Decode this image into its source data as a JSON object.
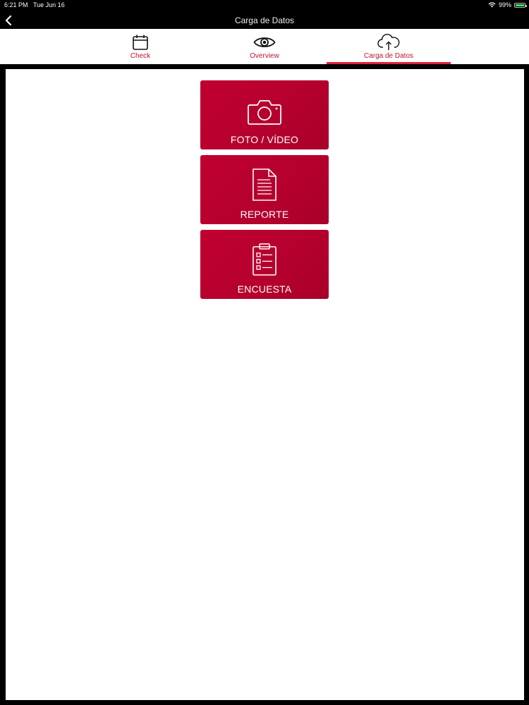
{
  "status_bar": {
    "time": "6:21 PM",
    "date": "Tue Jun 16",
    "battery": "99%"
  },
  "nav": {
    "title": "Carga de Datos",
    "back_icon": "chevron-left-icon"
  },
  "tabs": [
    {
      "label": "Check",
      "icon": "calendar-icon",
      "active": false
    },
    {
      "label": "Overview",
      "icon": "eye-icon",
      "active": false
    },
    {
      "label": "Carga de Datos",
      "icon": "cloud-upload-icon",
      "active": true
    }
  ],
  "actions": [
    {
      "label": "FOTO / VÍDEO",
      "icon": "camera-icon"
    },
    {
      "label": "REPORTE",
      "icon": "document-icon"
    },
    {
      "label": "ENCUESTA",
      "icon": "clipboard-checklist-icon"
    }
  ],
  "colors": {
    "accent": "#c8102e",
    "button_bg": "#b5002d",
    "tab_indicator": "#e0213c",
    "background": "#000000"
  }
}
